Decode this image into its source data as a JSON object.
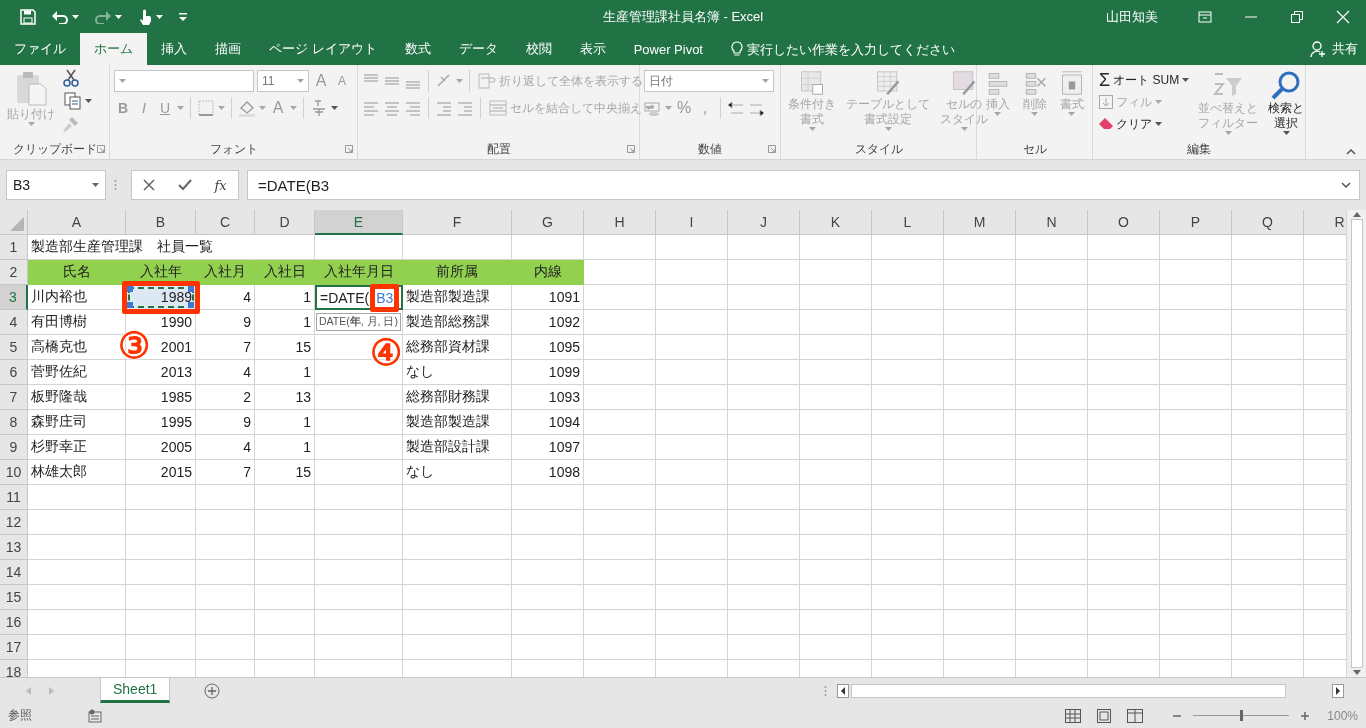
{
  "title_bar": {
    "title": "生産管理課社員名簿  -  Excel",
    "user": "山田知美"
  },
  "tabs": [
    {
      "label": "ファイル",
      "selected": false
    },
    {
      "label": "ホーム",
      "selected": true
    },
    {
      "label": "挿入",
      "selected": false
    },
    {
      "label": "描画",
      "selected": false
    },
    {
      "label": "ページ レイアウト",
      "selected": false
    },
    {
      "label": "数式",
      "selected": false
    },
    {
      "label": "データ",
      "selected": false
    },
    {
      "label": "校閲",
      "selected": false
    },
    {
      "label": "表示",
      "selected": false
    },
    {
      "label": "Power Pivot",
      "selected": false
    }
  ],
  "tell_me": {
    "placeholder": "実行したい作業を入力してください"
  },
  "share": "共有",
  "ribbon": {
    "clipboard": {
      "paste": {
        "label": "貼り付け",
        "disabled": true
      },
      "label": "クリップボード"
    },
    "font": {
      "size": "11",
      "grow": "A",
      "shrink": "A",
      "styles": [
        "B",
        "I",
        "U"
      ],
      "font_color": "A",
      "label": "フォント"
    },
    "alignment": {
      "wrap": {
        "label": "折り返して全体を表示する",
        "disabled": true
      },
      "merge": {
        "label": "セルを結合して中央揃え",
        "disabled": true
      },
      "label": "配置"
    },
    "number": {
      "format": "日付",
      "percent": "%",
      "comma": ",",
      "label": "数値"
    },
    "styles": {
      "buttons": [
        {
          "lines": [
            "条件付き",
            "書式"
          ],
          "disabled": true
        },
        {
          "lines": [
            "テーブルとして",
            "書式設定"
          ],
          "disabled": true
        },
        {
          "lines": [
            "セルの",
            "スタイル"
          ],
          "disabled": true
        }
      ],
      "label": "スタイル"
    },
    "cells": {
      "buttons": [
        {
          "lines": [
            "挿入"
          ],
          "disabled": true
        },
        {
          "lines": [
            "削除"
          ],
          "disabled": true
        },
        {
          "lines": [
            "書式"
          ],
          "disabled": true
        }
      ],
      "label": "セル"
    },
    "editing": {
      "autosum": {
        "symbol": "Σ",
        "label": "オート SUM",
        "disabled": false
      },
      "fill": {
        "label": "フィル",
        "disabled": true
      },
      "clear": {
        "label": "クリア",
        "disabled": false
      },
      "sort": {
        "lines": [
          "並べ替えと",
          "フィルター"
        ],
        "disabled": true
      },
      "find": {
        "lines": [
          "検索と",
          "選択"
        ],
        "disabled": false
      },
      "label": "編集"
    }
  },
  "formula_bar": {
    "name_box": "B3",
    "fx": "fx",
    "formula": "=DATE(B3"
  },
  "sheet": {
    "columns": [
      {
        "label": "A",
        "selected": false
      },
      {
        "label": "B",
        "selected": false,
        "right_aligned": true
      },
      {
        "label": "C",
        "selected": false,
        "right_aligned": true
      },
      {
        "label": "D",
        "selected": false,
        "right_aligned": true
      },
      {
        "label": "E",
        "selected": true
      },
      {
        "label": "F",
        "selected": false
      },
      {
        "label": "G",
        "selected": false,
        "right_aligned": true
      },
      {
        "label": "H",
        "selected": false
      },
      {
        "label": "I",
        "selected": false
      },
      {
        "label": "J",
        "selected": false
      },
      {
        "label": "K",
        "selected": false
      },
      {
        "label": "L",
        "selected": false
      },
      {
        "label": "M",
        "selected": false
      },
      {
        "label": "N",
        "selected": false
      },
      {
        "label": "O",
        "selected": false
      },
      {
        "label": "P",
        "selected": false
      },
      {
        "label": "Q",
        "selected": false
      },
      {
        "label": "R",
        "selected": false
      }
    ],
    "rows": [
      {
        "header": "1",
        "selected": false,
        "kind": "title",
        "cells": [
          "製造部生産管理課　社員一覧"
        ]
      },
      {
        "header": "2",
        "selected": false,
        "kind": "header",
        "cells": [
          "氏名",
          "入社年",
          "入社月",
          "入社日",
          "入社年月日",
          "前所属",
          "内線"
        ]
      },
      {
        "header": "3",
        "selected": true,
        "kind": "data",
        "cells": [
          "川内裕也",
          {
            "text": "1989",
            "marquee": true
          },
          "4",
          "1",
          {
            "text": "=DATE(",
            "ref": "B3",
            "editing": true
          },
          "製造部製造課",
          "1091"
        ]
      },
      {
        "header": "4",
        "selected": false,
        "kind": "data",
        "cells": [
          "有田博樹",
          "1990",
          "9",
          "1",
          null,
          "製造部総務課",
          "1092"
        ]
      },
      {
        "header": "5",
        "selected": false,
        "kind": "data",
        "cells": [
          "高橋克也",
          "2001",
          "7",
          "15",
          null,
          "総務部資材課",
          "1095"
        ]
      },
      {
        "header": "6",
        "selected": false,
        "kind": "data",
        "cells": [
          "菅野佐紀",
          "2013",
          "4",
          "1",
          null,
          "なし",
          "1099"
        ]
      },
      {
        "header": "7",
        "selected": false,
        "kind": "data",
        "cells": [
          "板野隆哉",
          "1985",
          "2",
          "13",
          null,
          "総務部財務課",
          "1093"
        ]
      },
      {
        "header": "8",
        "selected": false,
        "kind": "data",
        "cells": [
          "森野庄司",
          "1995",
          "9",
          "1",
          null,
          "製造部製造課",
          "1094"
        ]
      },
      {
        "header": "9",
        "selected": false,
        "kind": "data",
        "cells": [
          "杉野幸正",
          "2005",
          "4",
          "1",
          null,
          "製造部設計課",
          "1097"
        ]
      },
      {
        "header": "10",
        "selected": false,
        "kind": "data",
        "cells": [
          "林雄太郎",
          "2015",
          "7",
          "15",
          null,
          "なし",
          "1098"
        ]
      },
      {
        "header": "11",
        "selected": false
      },
      {
        "header": "12",
        "selected": false
      },
      {
        "header": "13",
        "selected": false
      },
      {
        "header": "14",
        "selected": false
      },
      {
        "header": "15",
        "selected": false
      },
      {
        "header": "16",
        "selected": false
      },
      {
        "header": "17",
        "selected": false
      },
      {
        "header": "18",
        "selected": false
      }
    ]
  },
  "tooltip": "DATE(**年**, 月, 日)",
  "callouts": [
    {
      "label": "③"
    },
    {
      "label": "④"
    }
  ],
  "sheet_tabs": [
    {
      "label": "Sheet1",
      "selected": true
    }
  ],
  "status_bar": {
    "mode": "参照",
    "zoom": "100%",
    "zoom_slider": {
      "level": 0.5
    }
  }
}
